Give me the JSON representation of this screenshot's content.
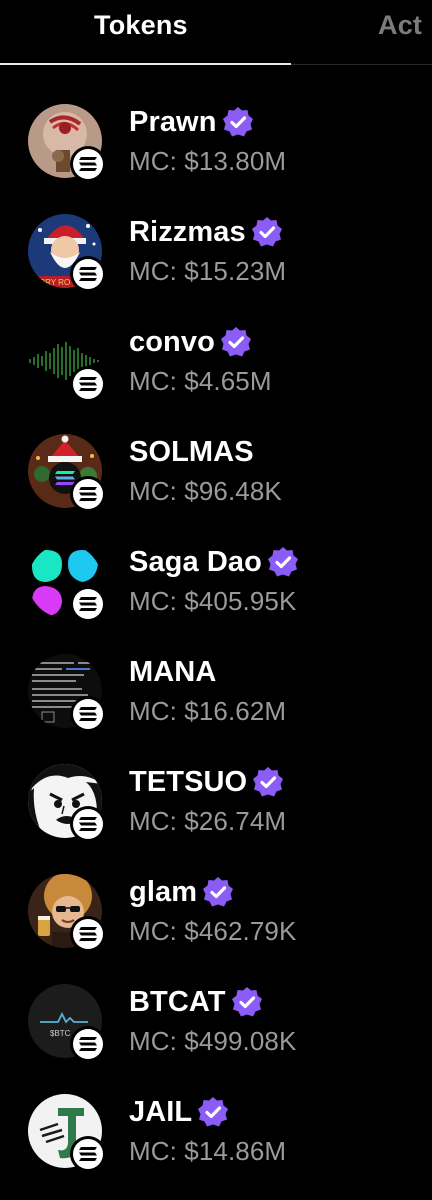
{
  "tabs": {
    "tokens": "Tokens",
    "activity": "Act"
  },
  "accent": "#8b5cf6",
  "tokens": [
    {
      "name": "Prawn",
      "mc": "MC: $13.80M",
      "verified": true
    },
    {
      "name": "Rizzmas",
      "mc": "MC: $15.23M",
      "verified": true
    },
    {
      "name": "convo",
      "mc": "MC: $4.65M",
      "verified": true
    },
    {
      "name": "SOLMAS",
      "mc": "MC: $96.48K",
      "verified": false
    },
    {
      "name": "Saga Dao",
      "mc": "MC: $405.95K",
      "verified": true
    },
    {
      "name": "MANA",
      "mc": "MC: $16.62M",
      "verified": false
    },
    {
      "name": "TETSUO",
      "mc": "MC: $26.74M",
      "verified": true
    },
    {
      "name": "glam",
      "mc": "MC: $462.79K",
      "verified": true
    },
    {
      "name": "BTCAT",
      "mc": "MC: $499.08K",
      "verified": true
    },
    {
      "name": "JAIL",
      "mc": "MC: $14.86M",
      "verified": true
    }
  ]
}
